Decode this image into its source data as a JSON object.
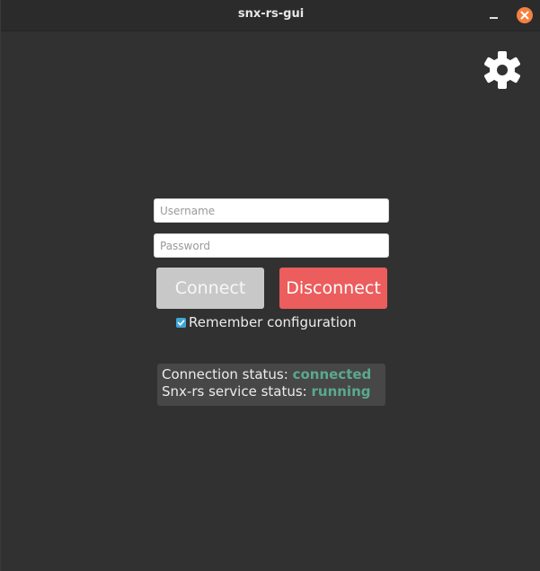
{
  "window": {
    "title": "snx-rs-gui"
  },
  "titlebar": {
    "minimize_icon": "minimize-icon",
    "close_icon": "close-icon",
    "close_color": "#f5813f"
  },
  "settings": {
    "icon": "gear-icon"
  },
  "form": {
    "username_placeholder": "Username",
    "username_value": "",
    "password_placeholder": "Password",
    "password_value": "",
    "connect_label": "Connect",
    "disconnect_label": "Disconnect",
    "disconnect_color": "#ec5d5d",
    "remember_label": "Remember configuration",
    "remember_checked": true
  },
  "status": {
    "connection_label": "Connection status:",
    "connection_value": "connected",
    "service_label": "Snx-rs service status:",
    "service_value": "running",
    "value_color": "#5aa98f"
  }
}
